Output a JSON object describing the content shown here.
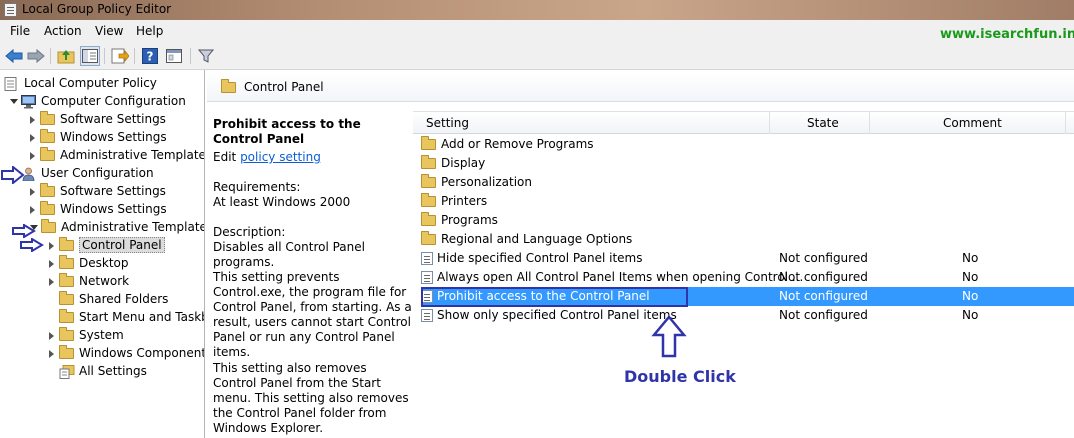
{
  "window": {
    "title": "Local Group Policy Editor"
  },
  "menu": [
    "File",
    "Action",
    "View",
    "Help"
  ],
  "watermark": "www.isearchfun.in",
  "tree": [
    {
      "label": "Local Computer Policy",
      "level": 0,
      "icon": "policy-icon",
      "expander": "none"
    },
    {
      "label": "Computer Configuration",
      "level": 1,
      "icon": "computer-icon",
      "expander": "open"
    },
    {
      "label": "Software Settings",
      "level": 2,
      "icon": "folder-icon",
      "expander": "closed"
    },
    {
      "label": "Windows Settings",
      "level": 2,
      "icon": "folder-icon",
      "expander": "closed"
    },
    {
      "label": "Administrative Templates",
      "level": 2,
      "icon": "folder-icon",
      "expander": "closed"
    },
    {
      "label": "User Configuration",
      "level": 1,
      "icon": "user-icon",
      "expander": "open"
    },
    {
      "label": "Software Settings",
      "level": 2,
      "icon": "folder-icon",
      "expander": "closed"
    },
    {
      "label": "Windows Settings",
      "level": 2,
      "icon": "folder-icon",
      "expander": "closed"
    },
    {
      "label": "Administrative Templates",
      "level": 2,
      "icon": "folder-icon",
      "expander": "open"
    },
    {
      "label": "Control Panel",
      "level": 3,
      "icon": "folder-icon",
      "expander": "closed",
      "selected": true
    },
    {
      "label": "Desktop",
      "level": 3,
      "icon": "folder-icon",
      "expander": "closed"
    },
    {
      "label": "Network",
      "level": 3,
      "icon": "folder-icon",
      "expander": "closed"
    },
    {
      "label": "Shared Folders",
      "level": 3,
      "icon": "folder-icon",
      "expander": "none"
    },
    {
      "label": "Start Menu and Taskbar",
      "level": 3,
      "icon": "folder-icon",
      "expander": "none"
    },
    {
      "label": "System",
      "level": 3,
      "icon": "folder-icon",
      "expander": "closed"
    },
    {
      "label": "Windows Components",
      "level": 3,
      "icon": "folder-icon",
      "expander": "closed"
    },
    {
      "label": "All Settings",
      "level": 3,
      "icon": "all-settings-icon",
      "expander": "none"
    }
  ],
  "header": {
    "title": "Control Panel"
  },
  "description": {
    "title": "Prohibit access to the Control Panel",
    "edit_prefix": "Edit ",
    "edit_link": "policy setting ",
    "requirements_label": "Requirements:",
    "requirements_value": "At least Windows 2000",
    "description_label": "Description:",
    "description_value": "Disables all Control Panel programs.",
    "para1": "This setting prevents Control.exe, the program file for Control Panel, from starting. As a result, users cannot start Control Panel or run any Control Panel items.",
    "para2": "This setting also removes Control Panel from the Start menu. This setting also removes the Control Panel folder from Windows Explorer."
  },
  "columns": {
    "setting": "Setting",
    "state": "State",
    "comment": "Comment"
  },
  "rows": [
    {
      "name": "Add or Remove Programs",
      "kind": "folder",
      "state": "",
      "comment": ""
    },
    {
      "name": "Display",
      "kind": "folder",
      "state": "",
      "comment": ""
    },
    {
      "name": "Personalization",
      "kind": "folder",
      "state": "",
      "comment": ""
    },
    {
      "name": "Printers",
      "kind": "folder",
      "state": "",
      "comment": ""
    },
    {
      "name": "Programs",
      "kind": "folder",
      "state": "",
      "comment": ""
    },
    {
      "name": "Regional and Language Options",
      "kind": "folder",
      "state": "",
      "comment": ""
    },
    {
      "name": "Hide specified Control Panel items",
      "kind": "policy",
      "state": "Not configured",
      "comment": "No"
    },
    {
      "name": "Always open All Control Panel Items when opening Control ...",
      "kind": "policy",
      "state": "Not configured",
      "comment": "No"
    },
    {
      "name": "Prohibit access to the Control Panel",
      "kind": "policy",
      "state": "Not configured",
      "comment": "No",
      "selected": true
    },
    {
      "name": "Show only specified Control Panel items",
      "kind": "policy",
      "state": "Not configured",
      "comment": "No"
    }
  ],
  "annotation": {
    "text": "Double Click",
    "color": "#2f35a8"
  },
  "colors": {
    "selection": "#3399ff",
    "link": "#0b5ed7",
    "watermark": "#1a9a1a"
  }
}
